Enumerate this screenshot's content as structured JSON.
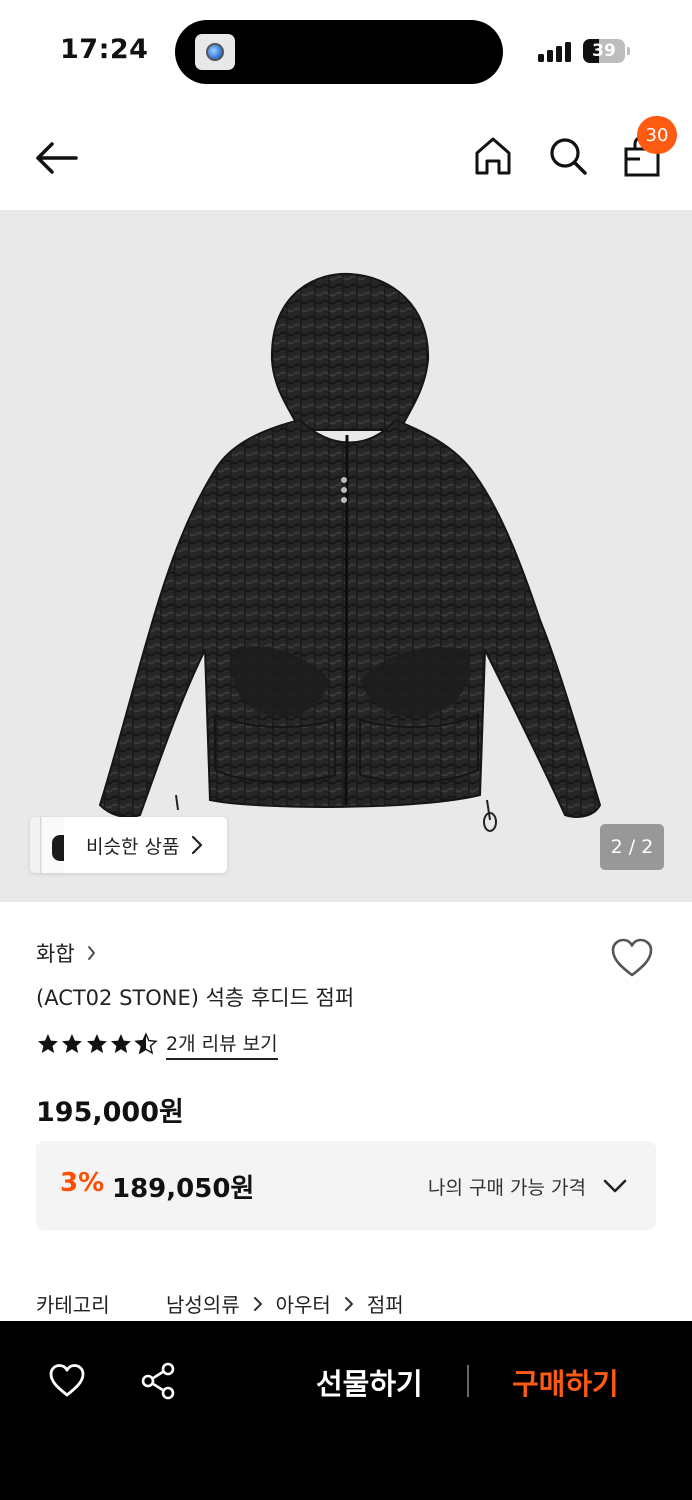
{
  "status_bar": {
    "time": "17:24",
    "battery": "39",
    "battery_level": 0.39
  },
  "nav": {
    "back_icon": "arrow-left-icon",
    "home_icon": "home-icon",
    "search_icon": "search-icon",
    "cart_icon": "shopping-bag-icon",
    "cart_count": "30",
    "badge_color": "#ff5a12"
  },
  "gallery": {
    "similar_label": "비슷한 상품",
    "page_indicator": "2 / 2",
    "image_desc_icon": "jacket-image"
  },
  "product": {
    "brand": "화합",
    "title": "(ACT02 STONE) 석층 후디드 점퍼",
    "rating": 4.5,
    "review_link": "2개 리뷰 보기",
    "original_price": "195,000원",
    "discount_rate": "3%",
    "discount_price": "189,050원",
    "my_price_label": "나의 구매 가능 가격",
    "accent_color": "#ff4d00"
  },
  "category": {
    "label": "카테고리",
    "path": [
      "남성의류",
      "아우터",
      "점퍼"
    ]
  },
  "bottom_bar": {
    "heart_icon": "heart-icon",
    "share_icon": "share-icon",
    "gift_label": "선물하기",
    "buy_label": "구매하기",
    "buy_color": "#ff5a12"
  }
}
